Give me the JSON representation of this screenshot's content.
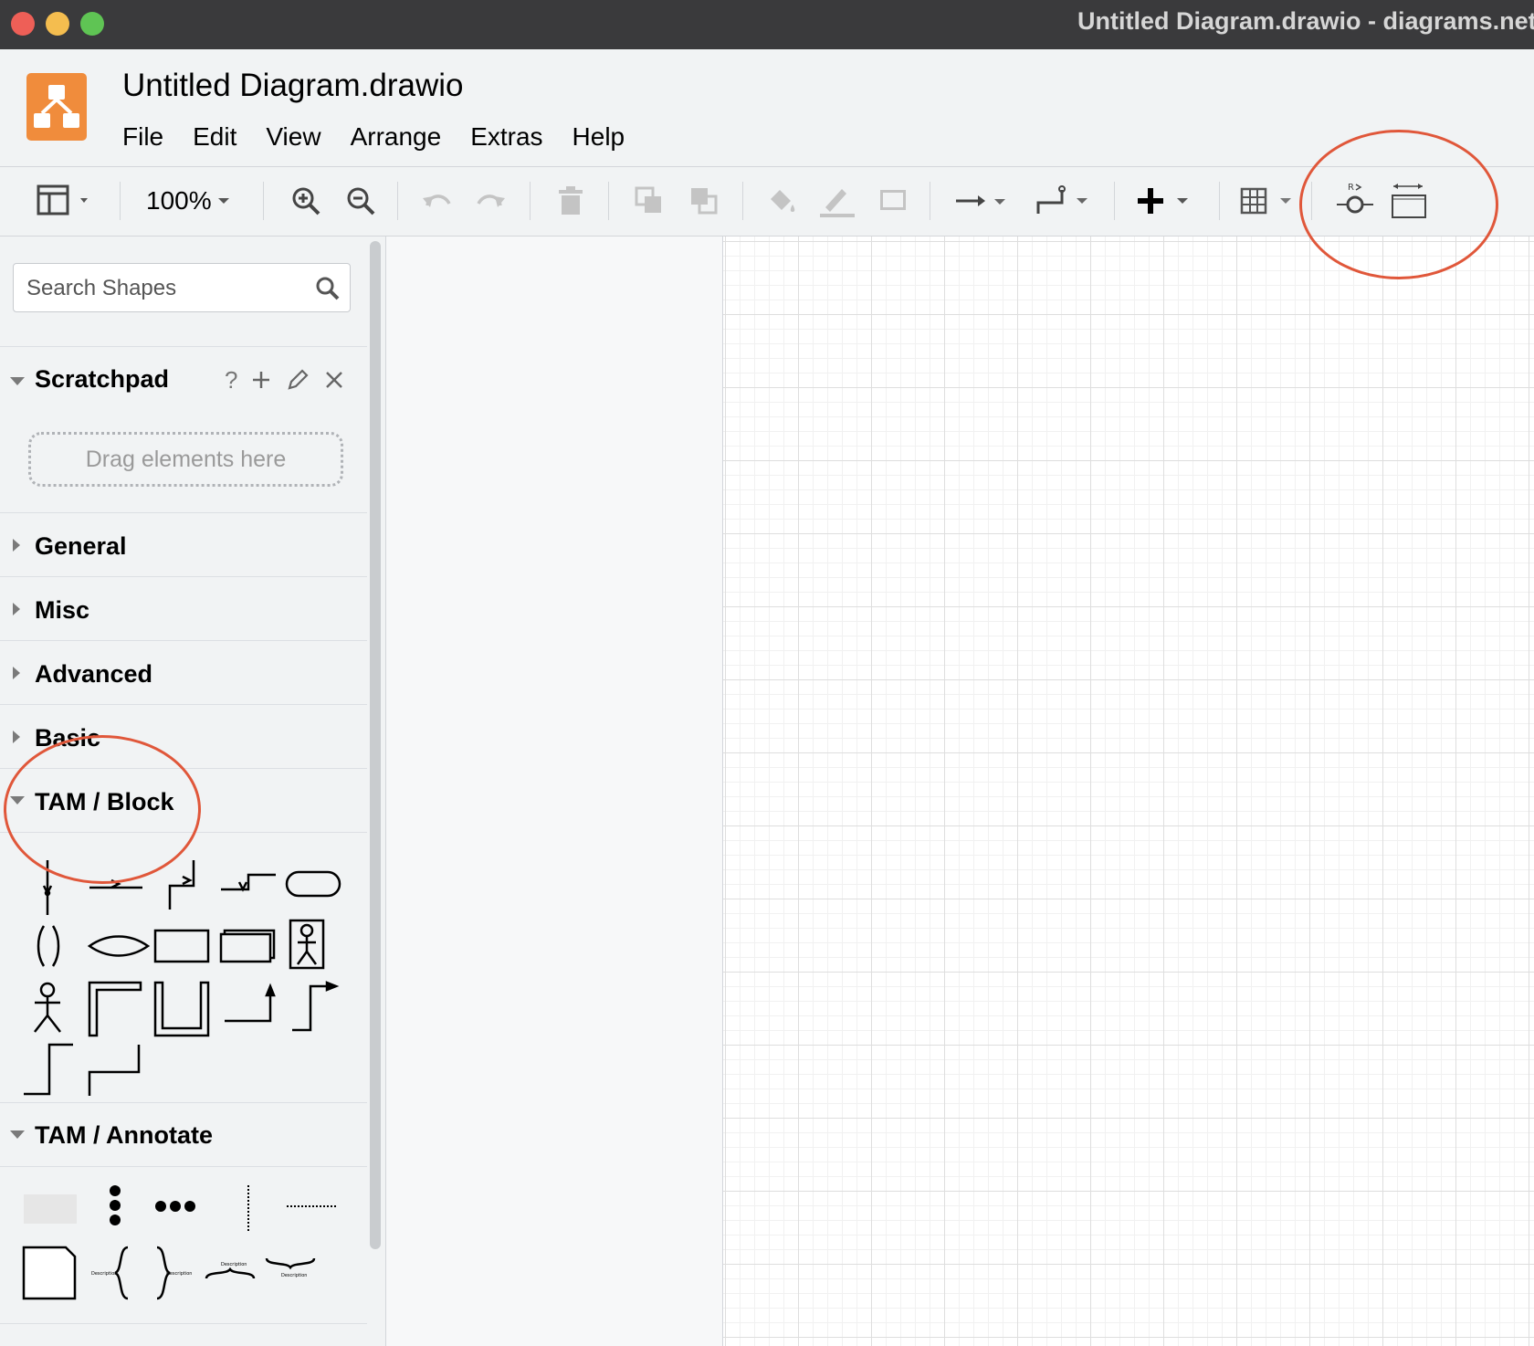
{
  "window": {
    "title": "Untitled Diagram.drawio - diagrams.net",
    "traffic_lights": {
      "close": "#ee5f57",
      "minimize": "#f4bd4f",
      "maximize": "#5fc454"
    }
  },
  "app": {
    "brand_color": "#f08c3c",
    "document_title": "Untitled Diagram.drawio"
  },
  "menu": {
    "items": [
      "File",
      "Edit",
      "View",
      "Arrange",
      "Extras",
      "Help"
    ]
  },
  "toolbar": {
    "zoom": "100%"
  },
  "sidebar": {
    "search_placeholder": "Search Shapes",
    "scratchpad": {
      "label": "Scratchpad",
      "help": "?",
      "dropzone": "Drag elements here"
    },
    "sections": {
      "general": "General",
      "misc": "Misc",
      "advanced": "Advanced",
      "basic": "Basic",
      "tam_block": "TAM / Block",
      "tam_annotate": "TAM / Annotate"
    },
    "annotate_desc": "Description"
  },
  "annotation_color": "#e0573a"
}
